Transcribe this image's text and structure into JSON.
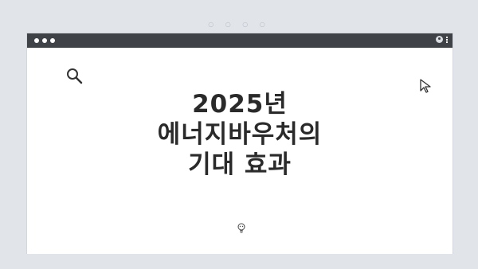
{
  "window": {
    "top_indicator": "○ ○ ○ ○"
  },
  "icons": {
    "search": "search-icon",
    "cursor": "cursor-arrow-icon",
    "bulb": "lightbulb-icon",
    "avatar": "user-avatar-icon",
    "menu": "kebab-menu-icon"
  },
  "slide": {
    "title_lines": [
      "2025년",
      "에너지바우처의",
      "기대 효과"
    ]
  },
  "colors": {
    "titlebar": "#3f4348",
    "background": "#e1e5ea",
    "text": "#2a2a2a"
  }
}
